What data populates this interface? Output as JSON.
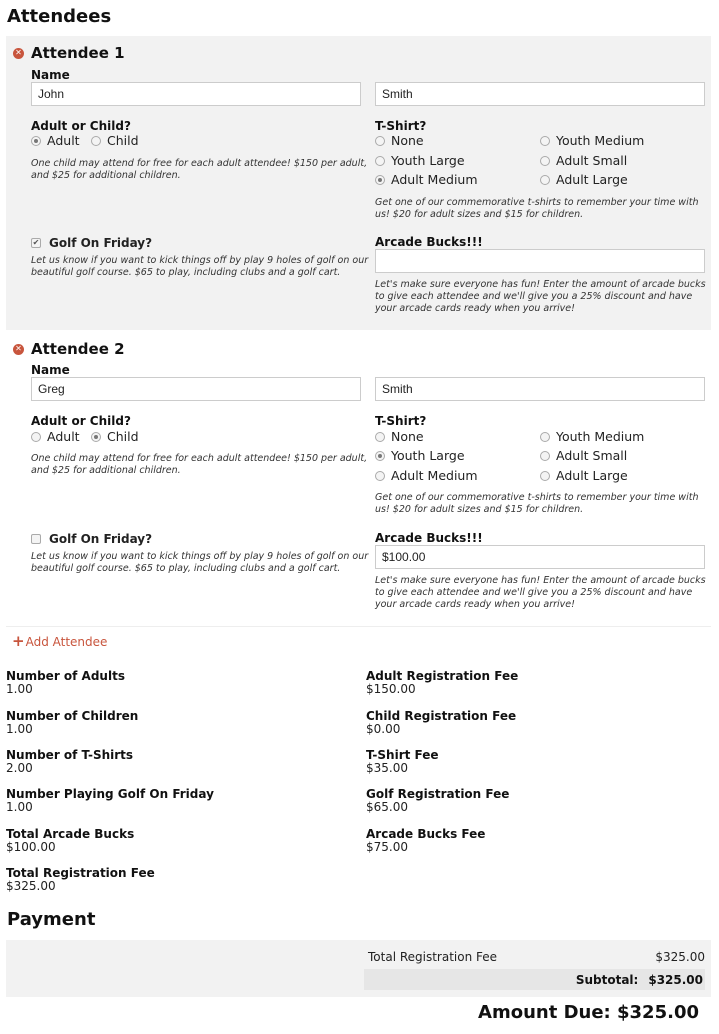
{
  "sections": {
    "attendees_title": "Attendees",
    "payment_title": "Payment"
  },
  "attendees": [
    {
      "title": "Attendee 1",
      "name_label": "Name",
      "first_name": "John",
      "last_name": "Smith",
      "type_label": "Adult or Child?",
      "type_options": [
        "Adult",
        "Child"
      ],
      "type_selected": "Adult",
      "type_help": "One child may attend for free for each adult attendee! $150 per adult, and $25 for additional children.",
      "tshirt_label": "T-Shirt?",
      "tshirt_options": [
        "None",
        "Youth Large",
        "Adult Medium",
        "Youth Medium",
        "Adult Small",
        "Adult Large"
      ],
      "tshirt_selected": "Adult Medium",
      "tshirt_help": "Get one of our commemorative t-shirts to remember your time with us! $20 for adult sizes and $15 for children.",
      "golf_label": "Golf On Friday?",
      "golf_checked": true,
      "golf_help": "Let us know if you want to kick things off by play 9 holes of golf on our beautiful golf course. $65 to play, including clubs and a golf cart.",
      "arcade_label": "Arcade Bucks!!!",
      "arcade_value": "",
      "arcade_help": "Let's make sure everyone has fun! Enter the amount of arcade bucks to give each attendee and we'll give you a 25% discount and have your arcade cards ready when you arrive!"
    },
    {
      "title": "Attendee 2",
      "name_label": "Name",
      "first_name": "Greg",
      "last_name": "Smith",
      "type_label": "Adult or Child?",
      "type_options": [
        "Adult",
        "Child"
      ],
      "type_selected": "Child",
      "type_help": "One child may attend for free for each adult attendee! $150 per adult, and $25 for additional children.",
      "tshirt_label": "T-Shirt?",
      "tshirt_options": [
        "None",
        "Youth Large",
        "Adult Medium",
        "Youth Medium",
        "Adult Small",
        "Adult Large"
      ],
      "tshirt_selected": "Youth Large",
      "tshirt_help": "Get one of our commemorative t-shirts to remember your time with us! $20 for adult sizes and $15 for children.",
      "golf_label": "Golf On Friday?",
      "golf_checked": false,
      "golf_help": "Let us know if you want to kick things off by play 9 holes of golf on our beautiful golf course. $65 to play, including clubs and a golf cart.",
      "arcade_label": "Arcade Bucks!!!",
      "arcade_value": "$100.00",
      "arcade_help": "Let's make sure everyone has fun! Enter the amount of arcade bucks to give each attendee and we'll give you a 25% discount and have your arcade cards ready when you arrive!"
    }
  ],
  "add_attendee_label": "Add Attendee",
  "summary_left": [
    {
      "label": "Number of Adults",
      "value": "1.00"
    },
    {
      "label": "Number of Children",
      "value": "1.00"
    },
    {
      "label": "Number of T-Shirts",
      "value": "2.00"
    },
    {
      "label": "Number Playing Golf On Friday",
      "value": "1.00"
    },
    {
      "label": "Total Arcade Bucks",
      "value": "$100.00"
    },
    {
      "label": "Total Registration Fee",
      "value": "$325.00"
    }
  ],
  "summary_right": [
    {
      "label": "Adult Registration Fee",
      "value": "$150.00"
    },
    {
      "label": "Child Registration Fee",
      "value": "$0.00"
    },
    {
      "label": "T-Shirt Fee",
      "value": "$35.00"
    },
    {
      "label": "Golf Registration Fee",
      "value": "$65.00"
    },
    {
      "label": "Arcade Bucks Fee",
      "value": "$75.00"
    }
  ],
  "payment": {
    "line_label": "Total Registration Fee",
    "line_value": "$325.00",
    "subtotal_label": "Subtotal:",
    "subtotal_value": "$325.00",
    "amount_due": "Amount Due: $325.00"
  },
  "colors": {
    "accent": "#c8553d",
    "panel": "#f2f2f2"
  }
}
